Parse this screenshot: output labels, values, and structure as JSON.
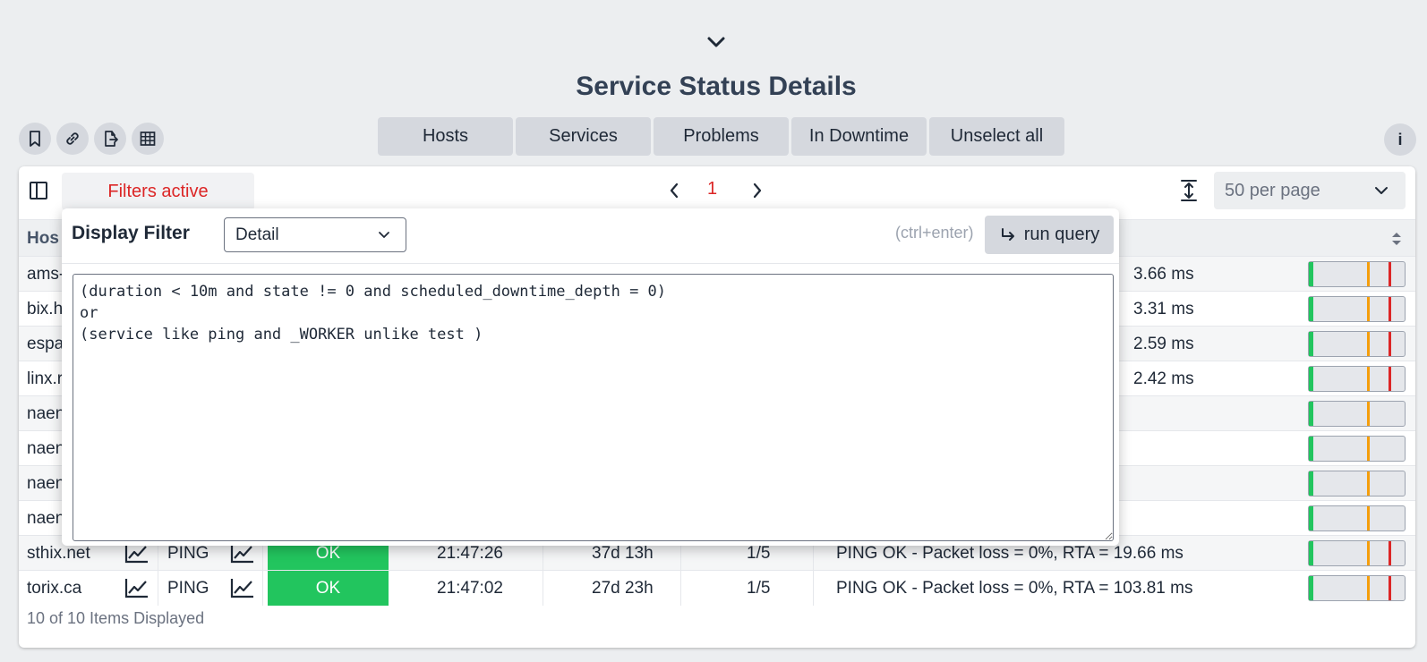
{
  "page": {
    "title": "Service Status Details"
  },
  "toolbar": {
    "icons": [
      "bookmark-icon",
      "link-icon",
      "export-icon",
      "table-icon"
    ]
  },
  "quick_filters": [
    {
      "label": "Hosts"
    },
    {
      "label": "Services"
    },
    {
      "label": "Problems"
    },
    {
      "label": "In Downtime"
    },
    {
      "label": "Unselect all"
    }
  ],
  "info_label": "i",
  "table_header": {
    "filters_label": "Filters active",
    "page": "1",
    "per_page": "50 per page",
    "host_column": "Hos"
  },
  "filter_popup": {
    "title": "Display Filter",
    "mode": "Detail",
    "hint": "(ctrl+enter)",
    "run_label": "run query",
    "query": "(duration < 10m and state != 0 and scheduled_downtime_depth = 0)\nor\n(service like ping and _WORKER unlike test )"
  },
  "rows": [
    {
      "host": "ams-",
      "service": "",
      "status": "",
      "last": "",
      "duration": "",
      "attempt": "",
      "output": "3.66 ms",
      "perf": {
        "ok": true,
        "warn": true,
        "crit": true
      }
    },
    {
      "host": "bix.h",
      "service": "",
      "status": "",
      "last": "",
      "duration": "",
      "attempt": "",
      "output": "3.31 ms",
      "perf": {
        "ok": true,
        "warn": true,
        "crit": true
      }
    },
    {
      "host": "espa",
      "service": "",
      "status": "",
      "last": "",
      "duration": "",
      "attempt": "",
      "output": "2.59 ms",
      "perf": {
        "ok": true,
        "warn": true,
        "crit": true
      }
    },
    {
      "host": "linx.r",
      "service": "",
      "status": "",
      "last": "",
      "duration": "",
      "attempt": "",
      "output": "2.42 ms",
      "perf": {
        "ok": true,
        "warn": true,
        "crit": true
      }
    },
    {
      "host": "naen",
      "service": "",
      "status": "",
      "last": "",
      "duration": "",
      "attempt": "",
      "output": "",
      "perf": {
        "ok": true,
        "warn": true,
        "crit": false
      }
    },
    {
      "host": "naen",
      "service": "",
      "status": "",
      "last": "",
      "duration": "",
      "attempt": "",
      "output": "",
      "perf": {
        "ok": true,
        "warn": true,
        "crit": false
      }
    },
    {
      "host": "naen",
      "service": "",
      "status": "",
      "last": "",
      "duration": "",
      "attempt": "",
      "output": "",
      "perf": {
        "ok": true,
        "warn": true,
        "crit": false
      }
    },
    {
      "host": "naen",
      "service": "",
      "status": "",
      "last": "",
      "duration": "",
      "attempt": "",
      "output": "",
      "perf": {
        "ok": true,
        "warn": true,
        "crit": false
      }
    },
    {
      "host": "sthix.net",
      "service": "PING",
      "status": "OK",
      "last": "21:47:26",
      "duration": "37d 13h",
      "attempt": "1/5",
      "output": "PING OK - Packet loss = 0%, RTA = 19.66 ms",
      "perf": {
        "ok": true,
        "warn": true,
        "crit": true
      }
    },
    {
      "host": "torix.ca",
      "service": "PING",
      "status": "OK",
      "last": "21:47:02",
      "duration": "27d 23h",
      "attempt": "1/5",
      "output": "PING OK - Packet loss = 0%, RTA = 103.81 ms",
      "perf": {
        "ok": true,
        "warn": true,
        "crit": true
      }
    }
  ],
  "footer": {
    "count_text": "10 of 10 Items Displayed"
  },
  "colors": {
    "ok": "#22c55e",
    "warning": "#f59e0b",
    "critical": "#dc2626",
    "accent_red": "#dc2626"
  }
}
